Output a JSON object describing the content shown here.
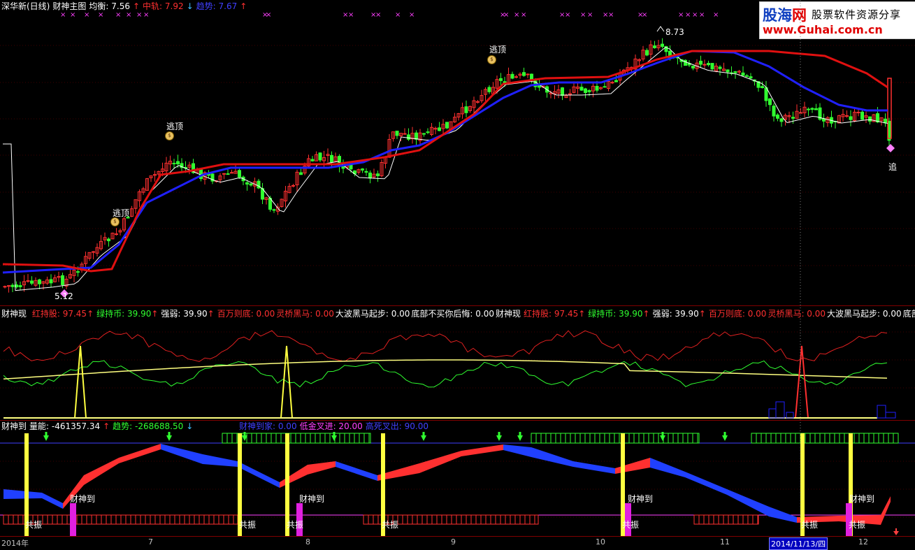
{
  "main_panel": {
    "stock_name": "深华新(日线)",
    "indicator_name": "财神主图",
    "avg_label": "均衡: 7.56",
    "mid_label": "中轨: 7.92",
    "trend_label": "趋势: 7.67",
    "up_arrow": "↑",
    "down_arrow": "↓",
    "high_marker": "8.73",
    "low_marker": "5.12",
    "escape_label": "逃顶",
    "chase_label": "追",
    "bag_glyph": "$"
  },
  "logo": {
    "brand_main": "股海",
    "brand_net": "网",
    "brand_tagline": "股票软件资源分享",
    "brand_url": "www.Guhai.com.cn"
  },
  "mid_panel": {
    "name": "财神现",
    "items": [
      {
        "label": "红持股: 97.45",
        "arrow": "↑",
        "color": "#ff3030"
      },
      {
        "label": "绿持币: 39.90",
        "arrow": "↑",
        "color": "#30ff30"
      },
      {
        "label": "强弱: 39.90",
        "arrow": "↑",
        "color": "#ffffff"
      },
      {
        "label": "百万则底: 0.00",
        "arrow": "",
        "color": "#ff3030"
      },
      {
        "label": "灵桥黑马: 0.00",
        "arrow": "",
        "color": "#ff3030"
      },
      {
        "label": "大波黑马起步: 0.00",
        "arrow": "",
        "color": "#ffffff"
      },
      {
        "label": "底部不买你后悔: 0.00",
        "arrow": "",
        "color": "#ffffff"
      }
    ],
    "repeat_name": "财神现",
    "repeat_items": [
      {
        "label": "红持股: 97.45",
        "arrow": "↑",
        "color": "#ff3030"
      },
      {
        "label": "绿持币: 39.90",
        "arrow": "↑",
        "color": "#30ff30"
      },
      {
        "label": "强弱: 39.90",
        "arrow": "↑",
        "color": "#ffffff"
      },
      {
        "label": "百万则底: 0.00",
        "arrow": "",
        "color": "#ff3030"
      },
      {
        "label": "灵桥黑马: 0.00",
        "arrow": "",
        "color": "#ff3030"
      },
      {
        "label": "大波黑马起步: 0.00",
        "arrow": "",
        "color": "#ffffff"
      },
      {
        "label": "底部不",
        "arrow": "",
        "color": "#ffffff"
      }
    ]
  },
  "bottom_panel": {
    "name": "财神到",
    "volume_label": "量能: -461357.34",
    "volume_arrow": "↑",
    "trend_label": "趋势: -268688.50",
    "trend_arrow": "↓",
    "home_label": "财神到家: 0.00",
    "gold_label": "低金叉进: 20.00",
    "sell_label": "高死叉出: 90.00",
    "arrive_label": "财神到",
    "resonance_label": "共振"
  },
  "date_axis": {
    "labels": [
      "2014年",
      "7",
      "8",
      "9",
      "10",
      "11",
      "2014/11/13/四",
      "12"
    ]
  },
  "colors": {
    "up": "#ff3030",
    "down": "#30ff30",
    "trend_blue": "#2020ff",
    "mid_red": "#e01010",
    "avg_white": "#ffffff",
    "grid": "#800000"
  }
}
